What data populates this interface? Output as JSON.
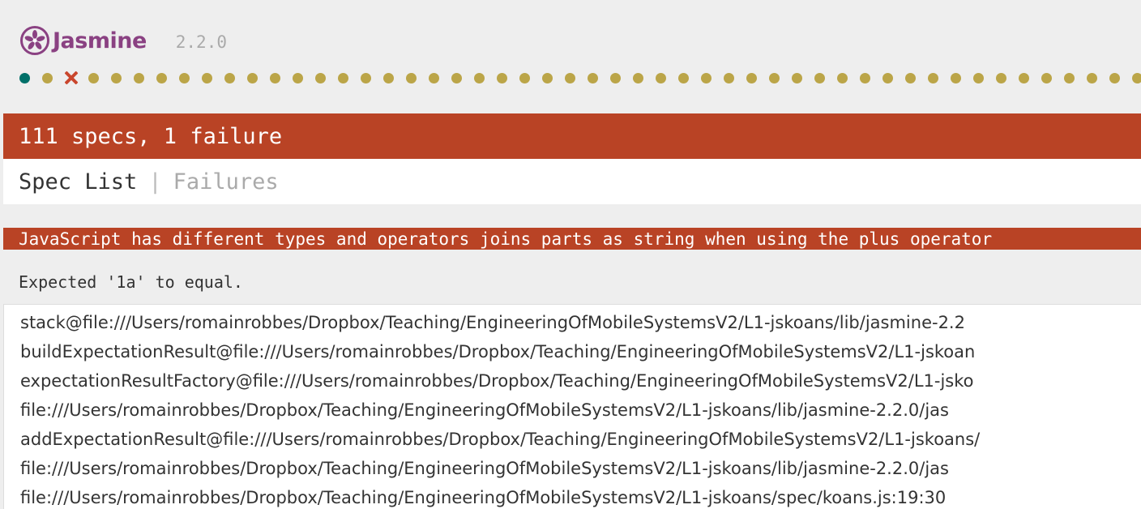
{
  "header": {
    "logo_text": "Jasmine",
    "version": "2.2.0",
    "brand_color": "#8a4182"
  },
  "results_bar": {
    "dots": [
      "passed",
      "passed",
      "failed",
      "passed",
      "passed",
      "passed",
      "passed",
      "passed",
      "passed",
      "passed",
      "passed",
      "passed",
      "passed",
      "passed",
      "passed",
      "passed",
      "passed",
      "passed",
      "passed",
      "passed",
      "passed",
      "passed",
      "passed",
      "passed",
      "passed",
      "passed",
      "passed",
      "passed",
      "passed",
      "passed",
      "passed",
      "passed",
      "passed",
      "passed",
      "passed",
      "passed",
      "passed",
      "passed",
      "passed",
      "passed",
      "passed",
      "passed",
      "passed",
      "passed",
      "passed",
      "passed",
      "passed",
      "passed",
      "passed",
      "passed"
    ],
    "passed_color": "#bba548",
    "failed_color": "#c9462d"
  },
  "summary": {
    "text": "111 specs, 1 failure",
    "color": "#b94325"
  },
  "menu": {
    "spec_list": "Spec List",
    "separator": "|",
    "failures": "Failures"
  },
  "failure": {
    "title": "JavaScript has different types and operators joins parts as string when using the plus operator",
    "message": "Expected '1a' to equal.",
    "stack": [
      "stack@file:///Users/romainrobbes/Dropbox/Teaching/EngineeringOfMobileSystemsV2/L1-jskoans/lib/jasmine-2.2",
      "buildExpectationResult@file:///Users/romainrobbes/Dropbox/Teaching/EngineeringOfMobileSystemsV2/L1-jskoan",
      "expectationResultFactory@file:///Users/romainrobbes/Dropbox/Teaching/EngineeringOfMobileSystemsV2/L1-jsko",
      "file:///Users/romainrobbes/Dropbox/Teaching/EngineeringOfMobileSystemsV2/L1-jskoans/lib/jasmine-2.2.0/jas",
      "addExpectationResult@file:///Users/romainrobbes/Dropbox/Teaching/EngineeringOfMobileSystemsV2/L1-jskoans/",
      "file:///Users/romainrobbes/Dropbox/Teaching/EngineeringOfMobileSystemsV2/L1-jskoans/lib/jasmine-2.2.0/jas",
      "file:///Users/romainrobbes/Dropbox/Teaching/EngineeringOfMobileSystemsV2/L1-jskoans/spec/koans.js:19:30"
    ]
  }
}
